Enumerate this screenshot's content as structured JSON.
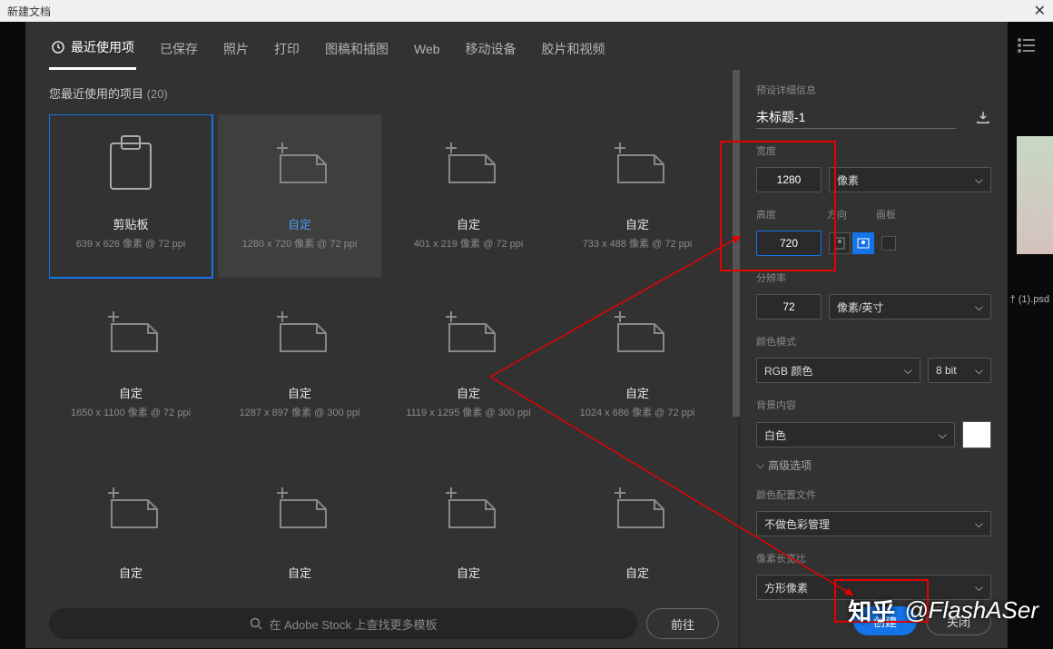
{
  "title": "新建文档",
  "tabs": [
    "最近使用项",
    "已保存",
    "照片",
    "打印",
    "图稿和插图",
    "Web",
    "移动设备",
    "胶片和视频"
  ],
  "recent_label": "您最近使用的项目",
  "recent_count": "(20)",
  "cards": [
    {
      "title": "剪贴板",
      "sub": "639 x 626 像素 @ 72 ppi",
      "kind": "clip",
      "selected": true
    },
    {
      "title": "自定",
      "sub": "1280 x 720 像素 @ 72 ppi",
      "kind": "page",
      "blue": true,
      "hover": true
    },
    {
      "title": "自定",
      "sub": "401 x 219 像素 @ 72 ppi",
      "kind": "page"
    },
    {
      "title": "自定",
      "sub": "733 x 488 像素 @ 72 ppi",
      "kind": "page"
    },
    {
      "title": "自定",
      "sub": "1650 x 1100 像素 @ 72 ppi",
      "kind": "page"
    },
    {
      "title": "自定",
      "sub": "1287 x 897 像素 @ 300 ppi",
      "kind": "page"
    },
    {
      "title": "自定",
      "sub": "1119 x 1295 像素 @ 300 ppi",
      "kind": "page"
    },
    {
      "title": "自定",
      "sub": "1024 x 686 像素 @ 72 ppi",
      "kind": "page"
    },
    {
      "title": "自定",
      "sub": "",
      "kind": "page"
    },
    {
      "title": "自定",
      "sub": "",
      "kind": "page"
    },
    {
      "title": "自定",
      "sub": "",
      "kind": "page"
    },
    {
      "title": "自定",
      "sub": "",
      "kind": "page"
    }
  ],
  "search": {
    "placeholder": "在 Adobe Stock 上查找更多模板",
    "go": "前往"
  },
  "preset": {
    "header": "预设详细信息",
    "name": "未标题-1",
    "width_label": "宽度",
    "width": "1280",
    "width_unit": "像素",
    "height_label": "高度",
    "height": "720",
    "orient_label": "方向",
    "artboard_label": "画板",
    "res_label": "分辨率",
    "res": "72",
    "res_unit": "像素/英寸",
    "cmode_label": "颜色模式",
    "cmode": "RGB 颜色",
    "cbit": "8 bit",
    "bg_label": "背景内容",
    "bg": "白色",
    "adv": "高级选项",
    "profile_label": "颜色配置文件",
    "profile": "不做色彩管理",
    "aspect_label": "像素长宽比",
    "aspect": "方形像素"
  },
  "buttons": {
    "create": "创建",
    "close": "关闭"
  },
  "watermark": {
    "zh": "知乎",
    "at": "@FlashASer"
  },
  "bg_file": "† (1).psd"
}
